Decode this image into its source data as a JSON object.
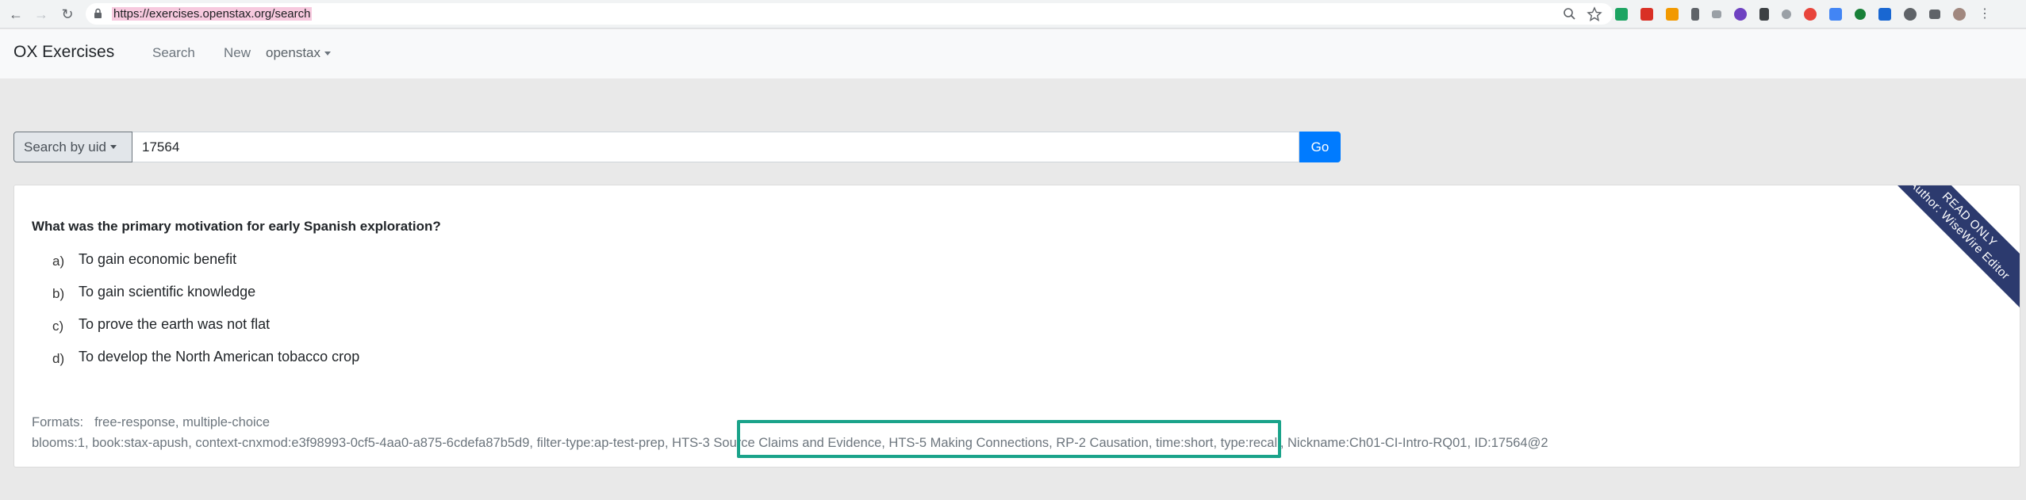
{
  "browser": {
    "url": "https://exercises.openstax.org/search",
    "extension_colors": [
      "#1da462",
      "#d93025",
      "#f29900",
      "#5f6368",
      "#9aa0a6",
      "#6f42c1",
      "#3c4043",
      "#1a73e8",
      "#e8453c",
      "#4285f4",
      "#188038",
      "#1967d2",
      "#5f6368"
    ]
  },
  "navbar": {
    "brand": "OX Exercises",
    "links": {
      "search": "Search",
      "new": "New",
      "account": "openstax"
    }
  },
  "search": {
    "mode_label": "Search by uid",
    "query": "17564",
    "go_label": "Go"
  },
  "exercise": {
    "ribbon_line1": "READ ONLY",
    "ribbon_line2": "Author: WiseWire Editor",
    "question": "What was the primary motivation for early Spanish exploration?",
    "answers": [
      {
        "letter": "a)",
        "text": "To gain economic benefit"
      },
      {
        "letter": "b)",
        "text": "To gain scientific knowledge"
      },
      {
        "letter": "c)",
        "text": "To prove the earth was not flat"
      },
      {
        "letter": "d)",
        "text": "To develop the North American tobacco crop"
      }
    ],
    "formats_label": "Formats:",
    "formats_value": "free-response, multiple-choice",
    "tags_before": "blooms:1,  book:stax-apush,  context-cnxmod:e3f98993-0cf5-4aa0-a875-6cdefa87b5d9,  filter-type:ap-test-prep,",
    "tags_highlighted": " HTS-3 Source Claims and Evidence,  HTS-5 Making Connections,  RP-2 Causation,",
    "tags_after": " time:short,  type:recall,  Nickname:Ch01-CI-Intro-RQ01,  ID:17564@2",
    "highlight_color": "#1aa38a"
  }
}
